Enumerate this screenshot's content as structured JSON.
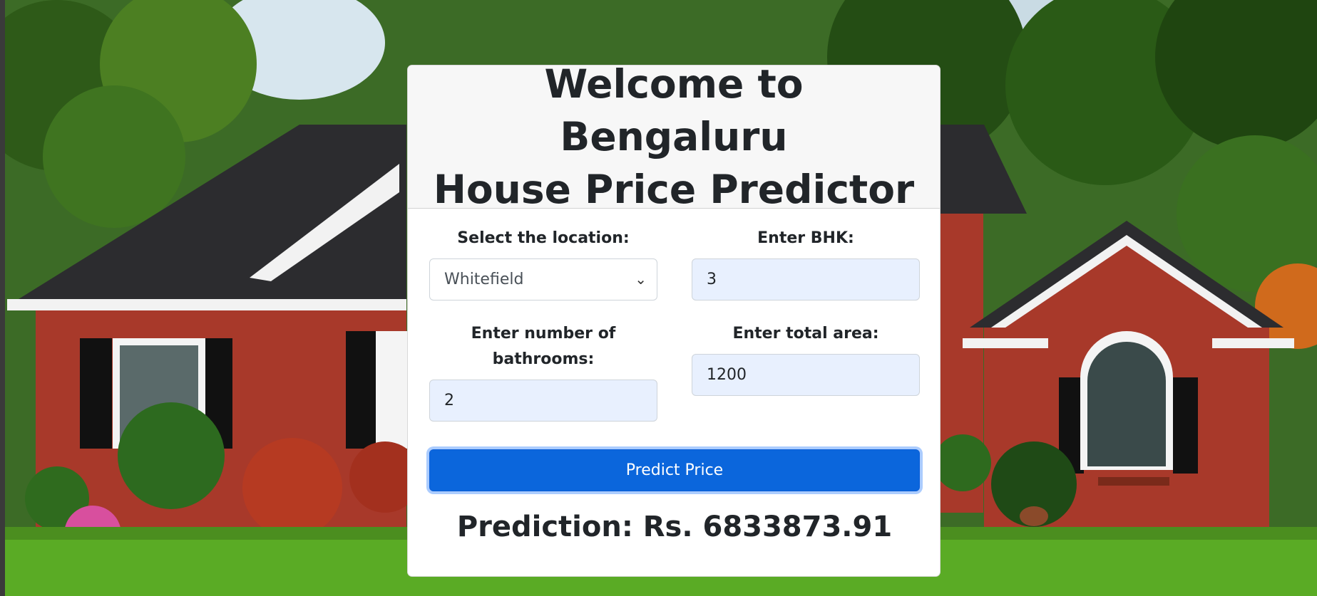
{
  "page": {
    "title_line1": "Welcome to Bengaluru",
    "title_line2": "House Price Predictor"
  },
  "form": {
    "location": {
      "label": "Select the location:",
      "selected": "Whitefield"
    },
    "bhk": {
      "label": "Enter BHK:",
      "value": "3"
    },
    "bathrooms": {
      "label": "Enter number of bathrooms:",
      "value": "2"
    },
    "area": {
      "label": "Enter total area:",
      "value": "1200"
    },
    "submit_label": "Predict Price"
  },
  "result": {
    "text": "Prediction: Rs. 6833873.91"
  },
  "colors": {
    "primary": "#0b66dc",
    "input_autofill": "#e8f0fe",
    "header_bg": "#f7f7f7"
  }
}
